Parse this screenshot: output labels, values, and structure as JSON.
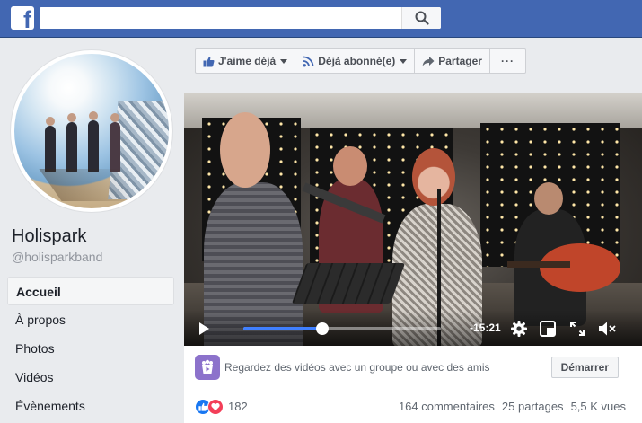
{
  "header": {
    "logo": "f",
    "search_placeholder": "",
    "search_icon": "search-icon",
    "brand_color": "#4267b2"
  },
  "profile": {
    "name": "Holispark",
    "handle": "@holisparkband"
  },
  "nav": {
    "items": [
      {
        "label": "Accueil",
        "active": true
      },
      {
        "label": "À propos"
      },
      {
        "label": "Photos"
      },
      {
        "label": "Vidéos"
      },
      {
        "label": "Évènements"
      }
    ]
  },
  "actions": {
    "like_label": "J'aime déjà",
    "follow_label": "Déjà abonné(e)",
    "share_label": "Partager",
    "more_label": "···"
  },
  "video": {
    "time_remaining": "-15:21",
    "progress_fraction": 0.4,
    "accent_color": "#4080ff"
  },
  "watch_party": {
    "text": "Regardez des vidéos avec un groupe ou avec des amis",
    "button_label": "Démarrer"
  },
  "stats": {
    "reactions_count": "182",
    "comments": "164 commentaires",
    "shares": "25 partages",
    "views": "5,5 K vues"
  }
}
